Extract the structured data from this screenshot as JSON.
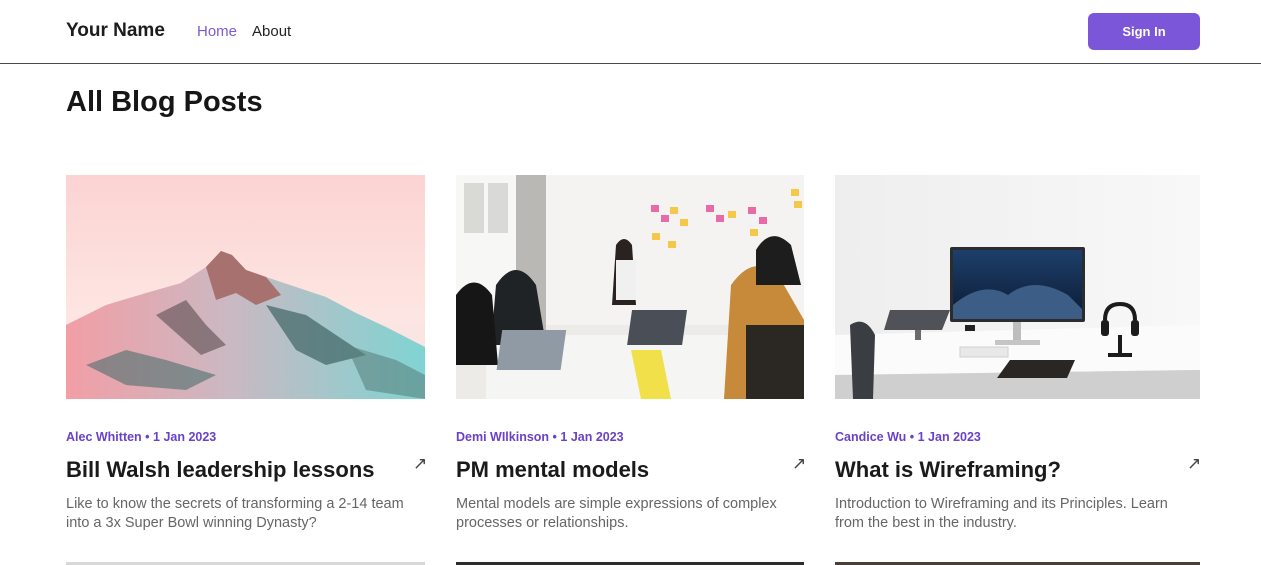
{
  "nav": {
    "brand": "Your Name",
    "links": [
      {
        "label": "Home",
        "active": true
      },
      {
        "label": "About",
        "active": false
      }
    ],
    "signin_label": "Sign In",
    "accent_color": "#7c56d8"
  },
  "page": {
    "title": "All Blog Posts"
  },
  "posts": [
    {
      "author": "Alec Whitten",
      "date": "1 Jan 2023",
      "meta": "Alec Whitten • 1 Jan 2023",
      "title": "Bill Walsh leadership lessons",
      "description": "Like to know the secrets of transforming a 2-14 team into a 3x Super Bowl winning Dynasty?",
      "image": "pastel-mountain-photo",
      "arrow_icon": "arrow-up-right-icon"
    },
    {
      "author": "Demi WIlkinson",
      "date": "1 Jan 2023",
      "meta": "Demi WIlkinson • 1 Jan 2023",
      "title": "PM mental models",
      "description": "Mental models are simple expressions of complex processes or relationships.",
      "image": "office-meeting-photo",
      "arrow_icon": "arrow-up-right-icon"
    },
    {
      "author": "Candice Wu",
      "date": "1 Jan 2023",
      "meta": "Candice Wu • 1 Jan 2023",
      "title": "What is Wireframing?",
      "description": "Introduction to Wireframing and its Principles. Learn from the best in the industry.",
      "image": "desk-setup-photo",
      "arrow_icon": "arrow-up-right-icon"
    }
  ],
  "arrow_glyph": "↗"
}
